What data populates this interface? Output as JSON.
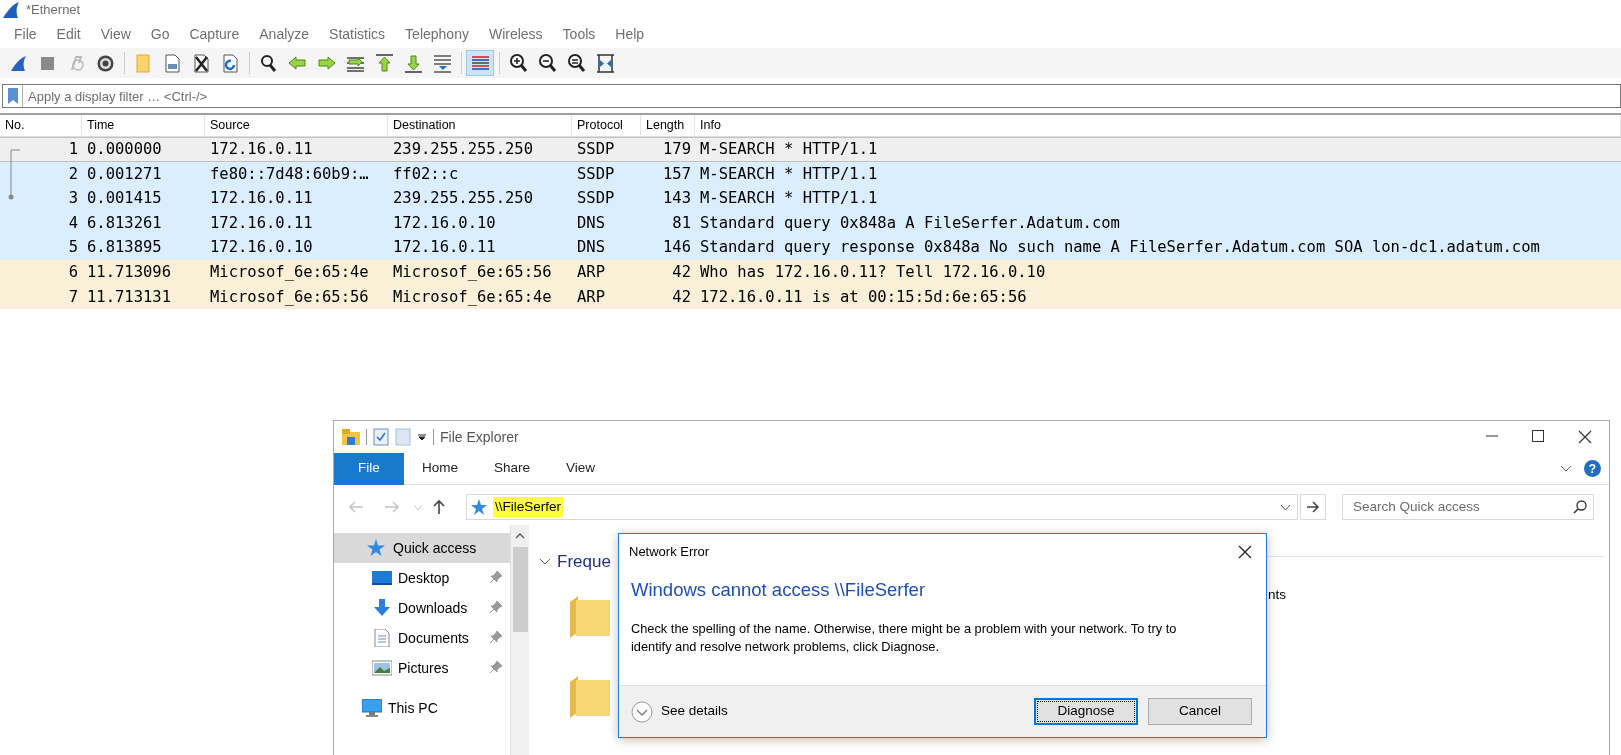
{
  "wireshark": {
    "title": "*Ethernet",
    "menu": [
      "File",
      "Edit",
      "View",
      "Go",
      "Capture",
      "Analyze",
      "Statistics",
      "Telephony",
      "Wireless",
      "Tools",
      "Help"
    ],
    "toolbar": [
      [
        {
          "kind": "start",
          "on": false
        },
        {
          "kind": "stop",
          "on": false
        },
        {
          "kind": "restart",
          "on": false
        },
        {
          "kind": "options",
          "on": false
        }
      ],
      [
        {
          "kind": "open",
          "on": false
        },
        {
          "kind": "save",
          "on": false
        },
        {
          "kind": "close",
          "on": false
        },
        {
          "kind": "reload",
          "on": false
        }
      ],
      [
        {
          "kind": "find",
          "on": false
        },
        {
          "kind": "back",
          "on": false
        },
        {
          "kind": "forward",
          "on": false
        },
        {
          "kind": "goto",
          "on": false
        },
        {
          "kind": "first",
          "on": false
        },
        {
          "kind": "last",
          "on": false
        },
        {
          "kind": "autoscroll",
          "on": false
        }
      ],
      [
        {
          "kind": "colorize",
          "on": true
        }
      ],
      [
        {
          "kind": "zoomin",
          "on": false
        },
        {
          "kind": "zoomout",
          "on": false
        },
        {
          "kind": "zoomreset",
          "on": false
        },
        {
          "kind": "resize",
          "on": false
        }
      ]
    ],
    "filter": {
      "placeholder": "Apply a display filter … <Ctrl-/>"
    },
    "columns": [
      "No.",
      "Time",
      "Source",
      "Destination",
      "Protocol",
      "Length",
      "Info"
    ],
    "packets": [
      {
        "no": "1",
        "time": "0.000000",
        "source": "172.16.0.11",
        "destination": "239.255.255.250",
        "protocol": "SSDP",
        "length": "179",
        "info": "M-SEARCH * HTTP/1.1",
        "selected": true
      },
      {
        "no": "2",
        "time": "0.001271",
        "source": "fe80::7d48:60b9:…",
        "destination": "ff02::c",
        "protocol": "SSDP",
        "length": "157",
        "info": "M-SEARCH * HTTP/1.1",
        "selected": false,
        "color": "#daeeff"
      },
      {
        "no": "3",
        "time": "0.001415",
        "source": "172.16.0.11",
        "destination": "239.255.255.250",
        "protocol": "SSDP",
        "length": "143",
        "info": "M-SEARCH * HTTP/1.1",
        "selected": false,
        "color": "#daeeff"
      },
      {
        "no": "4",
        "time": "6.813261",
        "source": "172.16.0.11",
        "destination": "172.16.0.10",
        "protocol": "DNS",
        "length": "81",
        "info": "Standard query 0x848a A FileSerfer.Adatum.com",
        "selected": false,
        "color": "#daeeff"
      },
      {
        "no": "5",
        "time": "6.813895",
        "source": "172.16.0.10",
        "destination": "172.16.0.11",
        "protocol": "DNS",
        "length": "146",
        "info": "Standard query response 0x848a No such name A FileSerfer.Adatum.com SOA lon-dc1.adatum.com",
        "selected": false,
        "color": "#daeeff"
      },
      {
        "no": "6",
        "time": "11.713096",
        "source": "Microsof_6e:65:4e",
        "destination": "Microsof_6e:65:56",
        "protocol": "ARP",
        "length": "42",
        "info": "Who has 172.16.0.11? Tell 172.16.0.10",
        "selected": false,
        "color": "#faf0d7"
      },
      {
        "no": "7",
        "time": "11.713131",
        "source": "Microsof_6e:65:56",
        "destination": "Microsof_6e:65:4e",
        "protocol": "ARP",
        "length": "42",
        "info": "172.16.0.11 is at 00:15:5d:6e:65:56",
        "selected": false,
        "color": "#faf0d7"
      }
    ]
  },
  "explorer": {
    "title": "File Explorer",
    "ribbon_tabs": [
      {
        "label": "File",
        "kind": "file"
      },
      {
        "label": "Home",
        "kind": "tab"
      },
      {
        "label": "Share",
        "kind": "tab"
      },
      {
        "label": "View",
        "kind": "tab"
      }
    ],
    "help": "?",
    "address": "\\\\FileSerfer",
    "search": {
      "placeholder": "Search Quick access"
    },
    "nav": [
      {
        "label": "Quick access",
        "kind": "star",
        "selected": true,
        "pinned": false,
        "children": [
          {
            "label": "Desktop",
            "kind": "desktop",
            "selected": false,
            "pinned": true
          },
          {
            "label": "Downloads",
            "kind": "download",
            "selected": false,
            "pinned": true
          },
          {
            "label": "Documents",
            "kind": "document",
            "selected": false,
            "pinned": true
          },
          {
            "label": "Pictures",
            "kind": "picture",
            "selected": false,
            "pinned": true
          }
        ]
      },
      {
        "label": "This PC",
        "kind": "pc",
        "selected": false,
        "pinned": false
      }
    ],
    "content": {
      "heading": "Freque",
      "item_text": "nts"
    }
  },
  "dialog": {
    "title": "Network Error",
    "heading": "Windows cannot access \\\\FileSerfer",
    "message": "Check the spelling of the name. Otherwise, there might be a problem with your network. To try to identify and resolve network problems, click Diagnose.",
    "details": "See details",
    "buttons": [
      {
        "label": "Diagnose",
        "default": true
      },
      {
        "label": "Cancel",
        "default": false
      }
    ]
  }
}
